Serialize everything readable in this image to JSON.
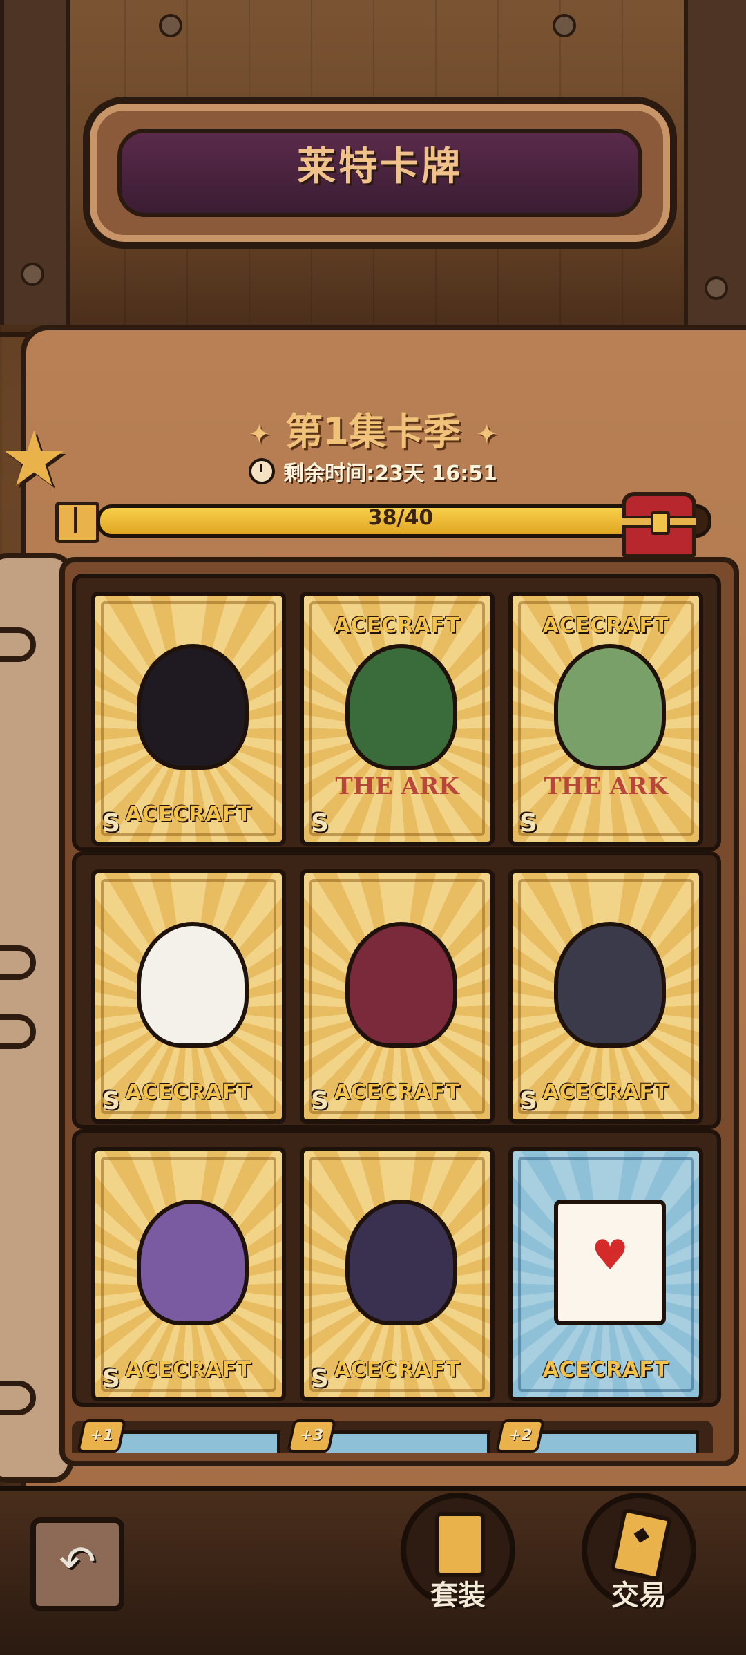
{
  "header": {
    "title": "莱特卡牌"
  },
  "season": {
    "title": "第1集卡季",
    "timer_text": "剩余时间:23天 16:51",
    "progress_text": "38/40",
    "progress_fraction": 0.95
  },
  "cards": [
    {
      "brand": "ACECRAFT",
      "rank": "S",
      "variant": "gold",
      "figure": "crown-king-character"
    },
    {
      "brand": "ACECRAFT",
      "sub": "THE ARK",
      "rank": "S",
      "variant": "gold",
      "figure": "green-helmet-character"
    },
    {
      "brand": "ACECRAFT",
      "sub": "THE ARK",
      "rank": "S",
      "variant": "gold",
      "figure": "ark-ship"
    },
    {
      "brand": "ACECRAFT",
      "rank": "S",
      "variant": "gold",
      "figure": "mountain-ghost-character"
    },
    {
      "brand": "ACECRAFT",
      "rank": "S",
      "variant": "gold",
      "figure": "bat-cat-character"
    },
    {
      "brand": "ACECRAFT",
      "rank": "S",
      "variant": "gold",
      "figure": "anubis-character"
    },
    {
      "brand": "ACECRAFT",
      "rank": "S",
      "variant": "gold",
      "figure": "purple-robot-character"
    },
    {
      "brand": "ACECRAFT",
      "rank": "S",
      "variant": "gold",
      "figure": "witch-character"
    },
    {
      "brand": "ACECRAFT",
      "rank": "",
      "variant": "blue",
      "figure": "playing-card-character"
    }
  ],
  "next_row_badges": [
    "+1",
    "+3",
    "+2"
  ],
  "bottom_nav": {
    "set_label": "套装",
    "trade_label": "交易"
  },
  "colors": {
    "accent_gold": "#e9b24a",
    "title_plate": "#5a2a4a",
    "card_blue": "#8ec0d8"
  }
}
